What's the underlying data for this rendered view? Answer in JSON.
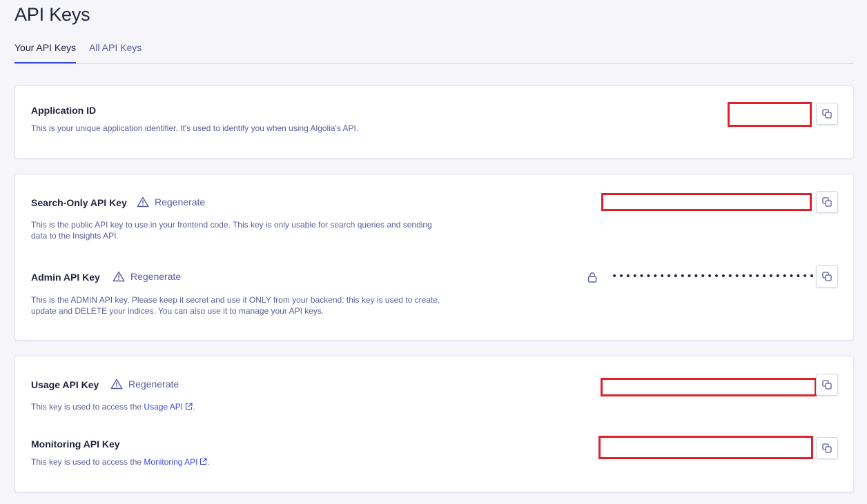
{
  "page": {
    "title": "API Keys"
  },
  "tabs": [
    {
      "label": "Your API Keys",
      "active": true
    },
    {
      "label": "All API Keys",
      "active": false
    }
  ],
  "application_id": {
    "title": "Application ID",
    "description": "This is your unique application identifier. It's used to identify you when using Algolia's API."
  },
  "search_only_key": {
    "title": "Search-Only API Key",
    "regenerate_label": "Regenerate",
    "description_line1": "This is the public API key to use in your frontend code. This key is only usable for search queries and sending",
    "description_line2": "data to the Insights API."
  },
  "admin_key": {
    "title": "Admin API Key",
    "regenerate_label": "Regenerate",
    "masked_value": "••••••••••••••••••••••••••••••••",
    "description_line1": "This is the ADMIN API key. Please keep it secret and use it ONLY from your backend: this key is used to create,",
    "description_line2": "update and DELETE your indices. You can also use it to manage your API keys."
  },
  "usage_key": {
    "title": "Usage API Key",
    "regenerate_label": "Regenerate",
    "description_prefix": "This key is used to access the ",
    "link_text": "Usage API",
    "description_suffix": "."
  },
  "monitoring_key": {
    "title": "Monitoring API Key",
    "description_prefix": "This key is used to access the ",
    "link_text": "Monitoring API",
    "description_suffix": "."
  },
  "colors": {
    "accent": "#3a46e0",
    "redaction": "#e0202a",
    "text_primary": "#21243d",
    "text_secondary": "#5a5e9a"
  }
}
